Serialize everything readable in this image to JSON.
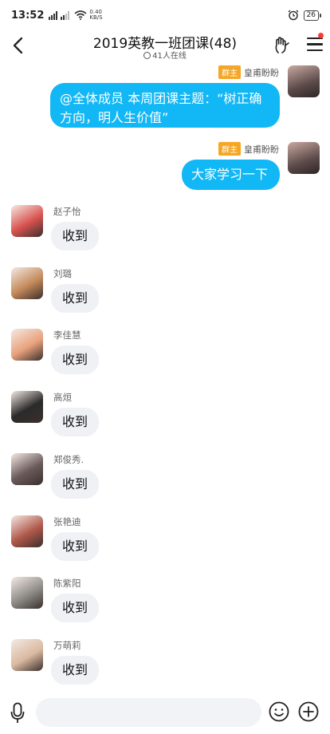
{
  "status_bar": {
    "time": "13:52",
    "net_speed_value": "0.40",
    "net_speed_unit": "KB/S",
    "battery": "26"
  },
  "header": {
    "title": "2019英教一班团课(48)",
    "online": "41人在线"
  },
  "self_messages": [
    {
      "badge": "群主",
      "name": "皇甫盼盼",
      "text_line1": "@全体成员 本周团课主题：“树正确",
      "text_line2": "方向，明人生价值”"
    },
    {
      "badge": "群主",
      "name": "皇甫盼盼",
      "text": "大家学习一下"
    }
  ],
  "messages": [
    {
      "name": "赵子怡",
      "text": "收到",
      "avatar_color": "#d9534f"
    },
    {
      "name": "刘璐",
      "text": "收到",
      "avatar_color": "#c48a5a"
    },
    {
      "name": "李佳慧",
      "text": "收到",
      "avatar_color": "#e8a27c"
    },
    {
      "name": "高烜",
      "text": "收到",
      "avatar_color": "#2b2b2b"
    },
    {
      "name": "郑俊秀.",
      "text": "收到",
      "avatar_color": "#6a5a5a"
    },
    {
      "name": "张艳迪",
      "text": "收到",
      "avatar_color": "#b0584a"
    },
    {
      "name": "陈紫阳",
      "text": "收到",
      "avatar_color": "#8f8c88"
    },
    {
      "name": "万萌莉",
      "text": "收到",
      "avatar_color": "#d9b9a0"
    }
  ],
  "input": {
    "placeholder": ""
  },
  "colors": {
    "self_bubble": "#12b7f5",
    "other_bubble": "#f0f1f5",
    "owner_badge": "#f5a623",
    "notification_dot": "#ff3b30"
  },
  "icons": [
    "back-arrow-icon",
    "hand-icon",
    "menu-icon",
    "mic-icon",
    "emoji-icon",
    "plus-icon",
    "alarm-icon",
    "wifi-icon",
    "signal-icon"
  ]
}
